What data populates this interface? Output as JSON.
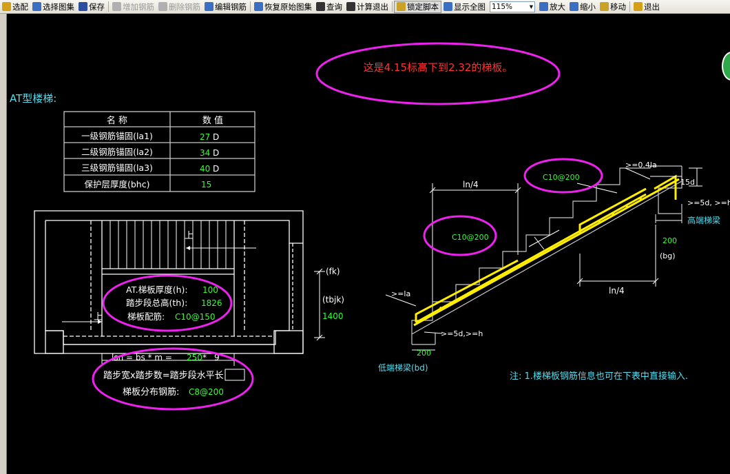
{
  "toolbar": {
    "items": [
      {
        "label": "选配",
        "state": "normal",
        "icon_color": "#d4a017"
      },
      {
        "label": "选择图集",
        "state": "normal",
        "icon_color": "#3a6fc4"
      },
      {
        "label": "保存",
        "state": "normal",
        "icon_color": "#2b4f9e"
      },
      {
        "label": "增加钢筋",
        "state": "disabled",
        "icon_color": "#b0b0b0"
      },
      {
        "label": "删除钢筋",
        "state": "disabled",
        "icon_color": "#b0b0b0"
      },
      {
        "label": "编辑钢筋",
        "state": "normal",
        "icon_color": "#3a6fc4"
      },
      {
        "label": "恢复原始图集",
        "state": "normal",
        "icon_color": "#3a6fc4"
      },
      {
        "label": "查询",
        "state": "normal",
        "icon_color": "#333333"
      },
      {
        "label": "计算退出",
        "state": "normal",
        "icon_color": "#333333"
      },
      {
        "label": "锁定脚本",
        "state": "active",
        "icon_color": "#c9a227"
      },
      {
        "label": "显示全图",
        "state": "normal",
        "icon_color": "#3a6fc4"
      }
    ],
    "zoom_value": "115%",
    "tail_items": [
      {
        "label": "放大",
        "icon_color": "#3a6fc4"
      },
      {
        "label": "缩小",
        "icon_color": "#3a6fc4"
      },
      {
        "label": "移动",
        "icon_color": "#c9a227"
      },
      {
        "label": "退出",
        "icon_color": "#d4a017"
      }
    ]
  },
  "colors": {
    "background": "#000000",
    "line": "#ffffff",
    "label_cyan": "#55ddee",
    "value_green": "#33ff33",
    "highlight_magenta": "#ee22ee",
    "rebar_yellow": "#ffee00",
    "note_red": "#ff3333"
  },
  "note_top": "这是4.15标高下到2.32的梯板。",
  "title": "AT型楼梯:",
  "param_table": {
    "headers": [
      "名 称",
      "数 值"
    ],
    "rows": [
      {
        "name": "一级钢筋锚固(la1)",
        "value": "27",
        "unit": "D"
      },
      {
        "name": "二级钢筋锚固(la2)",
        "value": "34",
        "unit": "D"
      },
      {
        "name": "三级钢筋锚固(la3)",
        "value": "40",
        "unit": "D"
      },
      {
        "name": "保护层厚度(bhc)",
        "value": "15",
        "unit": ""
      }
    ]
  },
  "plan": {
    "up_label": "上",
    "thickness_label": "AT.梯板厚度(h):",
    "thickness_value": "100",
    "height_label": "踏步段总高(th):",
    "height_value": "1826",
    "rebar_label": "梯板配筋:",
    "rebar_value": "C10@150",
    "fk_label": "(fk)",
    "tbjk_label": "(tbjk)",
    "tbjk_value": "1400",
    "lsn_formula_prefix": "lsn = bs * m = ",
    "lsn_bs": "250",
    "lsn_mult": " * ",
    "lsn_m": "9",
    "desc_line": "踏步宽x踏步数=踏步段水平长",
    "dist_label": "梯板分布钢筋:",
    "dist_value": "C8@200"
  },
  "section": {
    "top_rebar": "C10@200",
    "mid_rebar": "C10@200",
    "ln4_top": "ln/4",
    "ln4_bottom": "ln/4",
    "anchor_top": ">=0.4la",
    "anchor_left": ">=la",
    "d15": "15d",
    "ge5d_right": ">=5d, >=h",
    "ge5d_left": ">=5d,>=h",
    "high_beam": "高端梯梁",
    "low_beam": "低端梯梁(bd)",
    "w200_right": "200",
    "bg_label": "(bg)",
    "w200_left": "200"
  },
  "footnote": "注: 1.楼梯板钢筋信息也可在下表中直接输入."
}
